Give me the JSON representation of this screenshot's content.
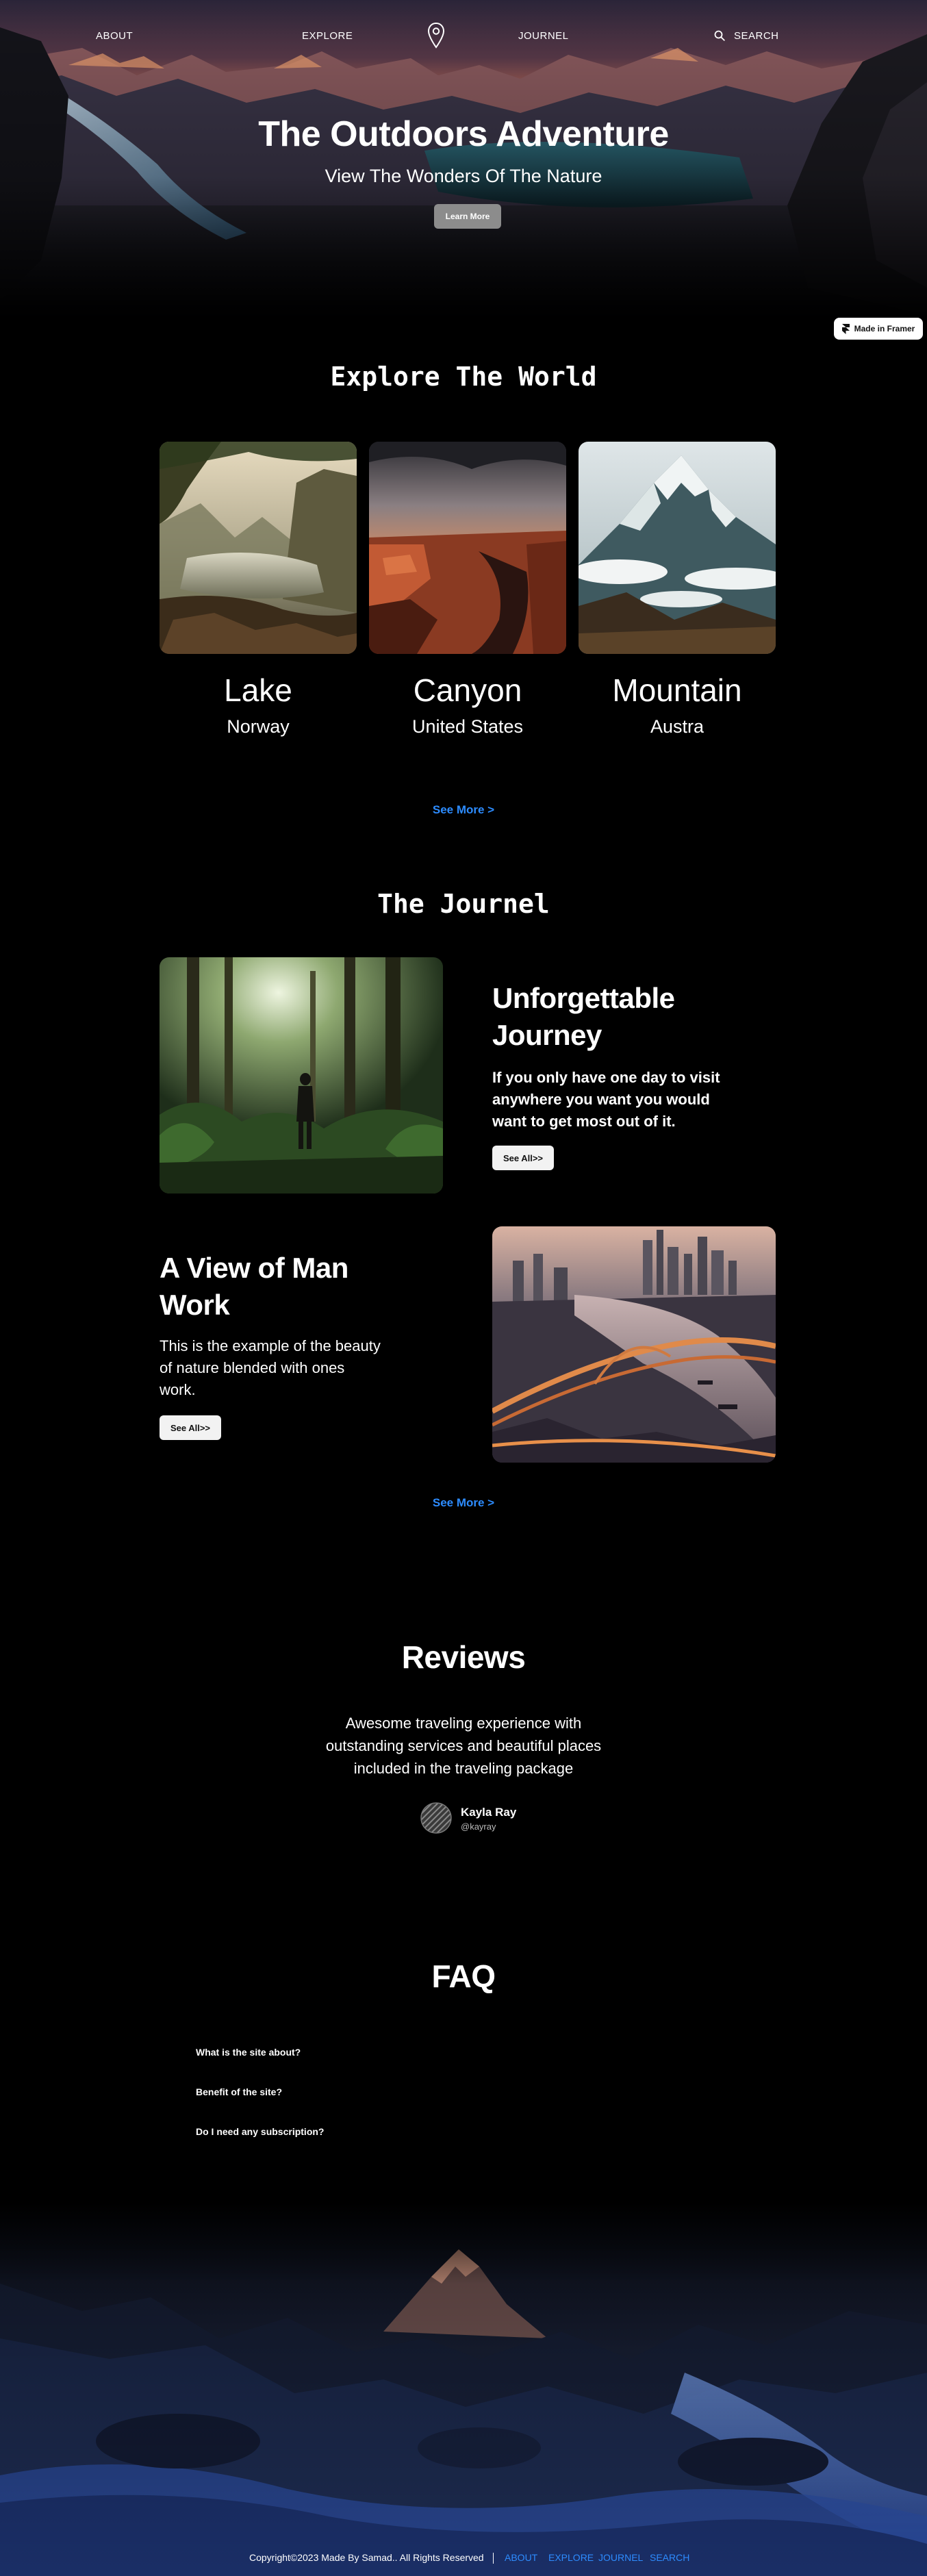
{
  "nav": {
    "about": "ABOUT",
    "explore": "EXPLORE",
    "journel": "JOURNEL",
    "search": "SEARCH",
    "pin_icon": "map-pin-icon",
    "search_icon": "search-icon"
  },
  "hero": {
    "title": "The Outdoors Adventure",
    "subtitle": "View The Wonders Of The Nature",
    "button": "Learn More"
  },
  "framer_badge": {
    "label": "Made in Framer",
    "icon": "framer-logo-icon"
  },
  "explore": {
    "heading": "Explore The World",
    "cards": [
      {
        "title": "Lake",
        "location": "Norway"
      },
      {
        "title": "Canyon",
        "location": "United States"
      },
      {
        "title": "Mountain",
        "location": "Austra"
      }
    ],
    "see_more": "See More >"
  },
  "journal": {
    "heading": "The Journel",
    "entries": [
      {
        "title_line1": "Unforgettable",
        "title_line2": "Journey",
        "text_line1": "If you only have one day to visit",
        "text_line2": "anywhere you want you would",
        "text_line3": "want to get most out of it.",
        "button": "See All>>"
      },
      {
        "title_line1": "A View of Man",
        "title_line2": "Work",
        "text_line1": "This is the example of the beauty",
        "text_line2": "of nature blended with ones",
        "text_line3": "work.",
        "button": "See All>>"
      }
    ],
    "see_more": "See More >"
  },
  "reviews": {
    "heading": "Reviews",
    "quote_line1": "Awesome traveling experience  with",
    "quote_line2": "outstanding services and beautiful places",
    "quote_line3": "included in the traveling package",
    "name": "Kayla Ray",
    "handle": "@kayray"
  },
  "faq": {
    "heading": "FAQ",
    "questions": [
      "What is the site about?",
      "Benefit of the site?",
      "Do I need any subscription?"
    ]
  },
  "footer": {
    "copyright": "Copyright©2023 Made By Samad.. All Rights Reserved",
    "links": [
      "ABOUT",
      "EXPLORE",
      "JOURNEL",
      "SEARCH"
    ]
  },
  "colors": {
    "background": "#000000",
    "accent_link": "#2d8cff",
    "hero_button": "#8c8c8c",
    "button_light": "#f2f2f2"
  }
}
